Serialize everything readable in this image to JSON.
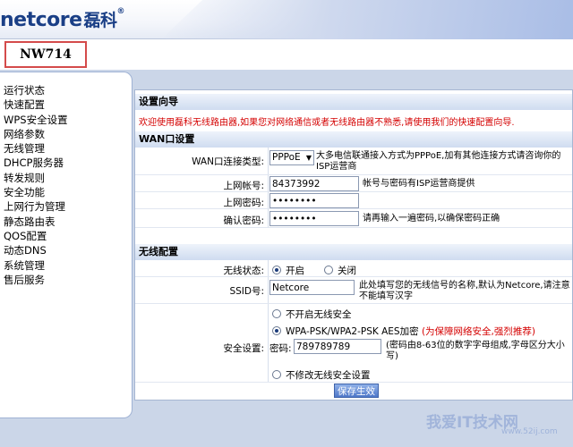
{
  "header": {
    "logo_text": "netcore",
    "logo_cn": "磊科",
    "model": "NW714"
  },
  "sidebar": {
    "items": [
      "运行状态",
      "快速配置",
      "WPS安全设置",
      "网络参数",
      "无线管理",
      "DHCP服务器",
      "转发规则",
      "安全功能",
      "上网行为管理",
      "静态路由表",
      "QOS配置",
      "动态DNS",
      "系统管理",
      "售后服务"
    ]
  },
  "wizard": {
    "title": "设置向导",
    "notice": "欢迎使用磊科无线路由器,如果您对网络通信或者无线路由器不熟悉,请使用我们的快速配置向导."
  },
  "wan": {
    "title": "WAN口设置",
    "type_label": "WAN口连接类型:",
    "type_value": "PPPoE",
    "type_desc": "大多电信联通接入方式为PPPoE,加有其他连接方式请咨询你的ISP运营商",
    "account_label": "上网帐号:",
    "account_value": "84373992",
    "account_desc": "帐号与密码有ISP运营商提供",
    "password_label": "上网密码:",
    "password_value": "••••••••",
    "confirm_label": "确认密码:",
    "confirm_value": "••••••••",
    "confirm_desc": "请再输入一遍密码,以确保密码正确"
  },
  "wireless": {
    "title": "无线配置",
    "status_label": "无线状态:",
    "status_on": "开启",
    "status_off": "关闭",
    "ssid_label": "SSID号:",
    "ssid_value": "Netcore",
    "ssid_desc": "此处填写您的无线信号的名称,默认为Netcore,请注意不能填写汉字",
    "security_label": "安全设置:",
    "opt_none": "不开启无线安全",
    "opt_wpa": "WPA-PSK/WPA2-PSK AES加密",
    "opt_wpa_note": "(为保障网络安全,强烈推荐)",
    "pwd_label": "密码:",
    "pwd_value": "789789789",
    "pwd_desc": "(密码由8-63位的数字字母组成,字母区分大小写)",
    "opt_keep": "不修改无线安全设置"
  },
  "buttons": {
    "save": "保存生效"
  },
  "watermark": {
    "main": "我爱IT技术网",
    "sub": "www.52ij.com"
  }
}
